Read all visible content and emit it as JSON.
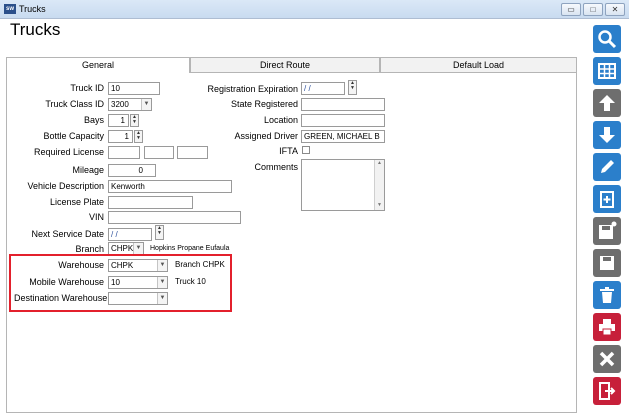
{
  "window": {
    "title": "Trucks",
    "min_label": "▭",
    "max_label": "□",
    "close_label": "✕"
  },
  "page_title": "Trucks",
  "tabs": {
    "general": "General",
    "direct_route": "Direct Route",
    "default_load": "Default Load"
  },
  "form": {
    "truck_id": {
      "label": "Truck ID",
      "value": "10"
    },
    "truck_class_id": {
      "label": "Truck Class ID",
      "value": "3200"
    },
    "bays": {
      "label": "Bays",
      "value": "1"
    },
    "bottle_capacity": {
      "label": "Bottle Capacity",
      "value": "1"
    },
    "required_license": {
      "label": "Required License"
    },
    "mileage": {
      "label": "Mileage",
      "value": "0"
    },
    "vehicle_description": {
      "label": "Vehicle Description",
      "value": "Kenworth"
    },
    "license_plate": {
      "label": "License Plate",
      "value": ""
    },
    "vin": {
      "label": "VIN",
      "value": ""
    },
    "next_service_date": {
      "label": "Next Service Date",
      "value": "/ /"
    },
    "branch": {
      "label": "Branch",
      "value": "CHPK",
      "description": "Hopkins Propane Eufaula"
    },
    "warehouse": {
      "label": "Warehouse",
      "value": "CHPK",
      "description": "Branch CHPK"
    },
    "mobile_warehouse": {
      "label": "Mobile Warehouse",
      "value": "10",
      "description": "Truck 10"
    },
    "destination_warehouse": {
      "label": "Destination Warehouse",
      "value": ""
    },
    "registration_expiration": {
      "label": "Registration Expiration",
      "value": "/ /"
    },
    "state_registered": {
      "label": "State Registered",
      "value": ""
    },
    "location": {
      "label": "Location",
      "value": ""
    },
    "assigned_driver": {
      "label": "Assigned Driver",
      "value": "GREEN, MICHAEL B"
    },
    "ifta": {
      "label": "IFTA",
      "checked": false
    },
    "comments": {
      "label": "Comments",
      "value": ""
    }
  },
  "toolbar": [
    "search-icon",
    "grid-icon",
    "arrow-up-icon",
    "arrow-down-icon",
    "edit-icon",
    "add-document-icon",
    "save-as-icon",
    "save-icon",
    "delete-icon",
    "print-icon",
    "cancel-icon",
    "exit-icon"
  ],
  "colors": {
    "highlight": "#e3202c",
    "toolbar_blue": "#2b7fcb",
    "toolbar_gray": "#6e6e6e",
    "toolbar_red": "#c7203a"
  }
}
